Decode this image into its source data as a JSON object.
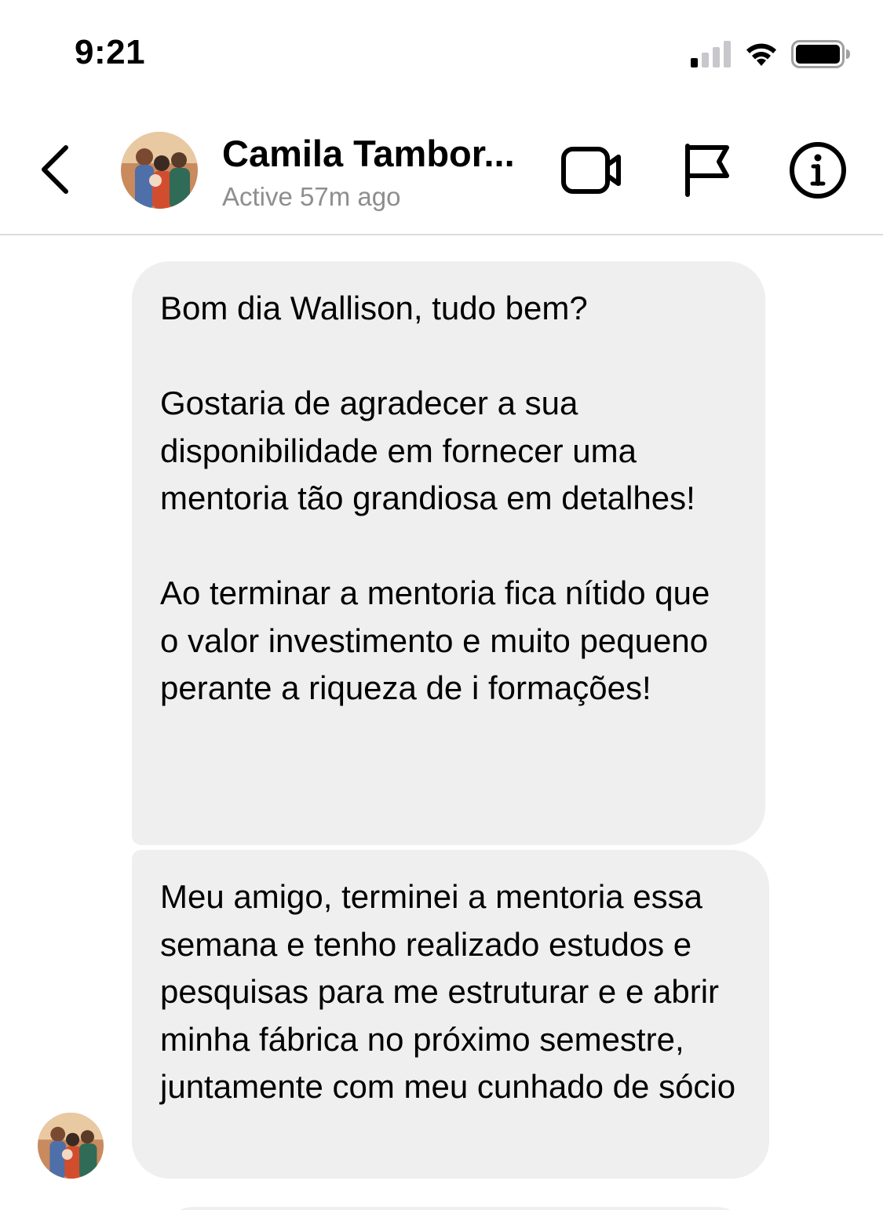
{
  "status_bar": {
    "time": "9:21"
  },
  "header": {
    "contact_name": "Camila Tambor...",
    "contact_status": "Active 57m ago",
    "icons": {
      "back": "chevron-left-icon",
      "video": "video-camera-icon",
      "flag": "flag-icon",
      "info": "info-icon"
    }
  },
  "messages": [
    {
      "text": "Bom dia Wallison, tudo bem?\n\nGostaria de agradecer a sua disponibilidade em fornecer uma mentoria tão grandiosa em detalhes!\n\nAo terminar a mentoria fica nítido que o valor investimento e muito pequeno perante a riqueza de i formações!"
    },
    {
      "text": "Meu amigo, terminei a mentoria essa semana e tenho realizado estudos e pesquisas para me estruturar e e abrir minha fábrica no próximo semestre, juntamente com meu cunhado de sócio"
    }
  ],
  "colors": {
    "bubble_bg": "#efefef",
    "secondary_text": "#8e8e8e",
    "divider": "#dbdbdb"
  }
}
